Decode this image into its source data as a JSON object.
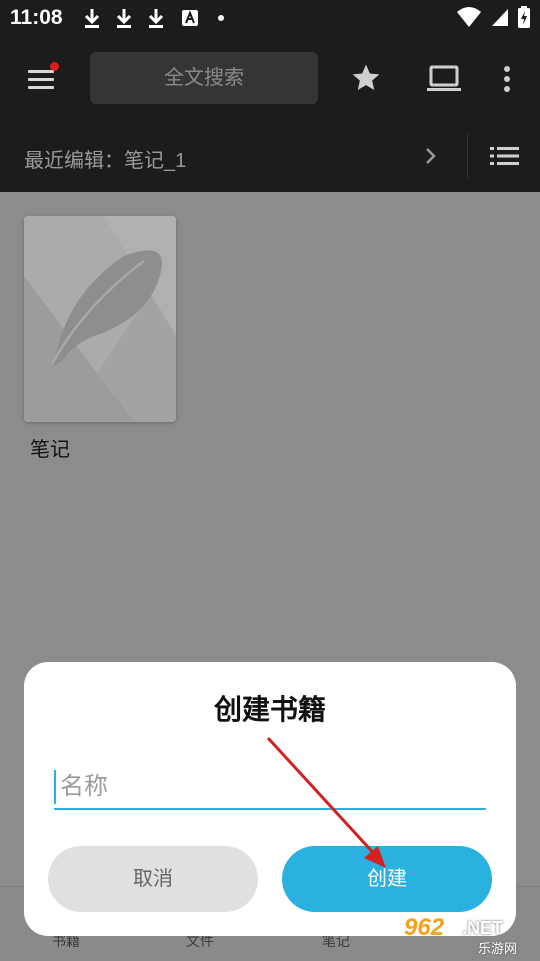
{
  "status_bar": {
    "time": "11:08",
    "notification_icons": [
      "download-icon",
      "download-icon",
      "download-icon",
      "text-icon"
    ],
    "system_icons": [
      "wifi-icon",
      "signal-icon",
      "battery-charging-icon"
    ]
  },
  "app_bar": {
    "search_placeholder": "全文搜索",
    "icons": [
      "menu-icon",
      "star-icon",
      "laptop-icon",
      "more-vertical-icon"
    ],
    "badge_color": "#e01b1b"
  },
  "recent": {
    "label": "最近编辑：笔记_1"
  },
  "books": [
    {
      "title": "笔记"
    }
  ],
  "bottom_nav": {
    "tabs": [
      "书籍",
      "文件",
      "笔记"
    ]
  },
  "dialog": {
    "title": "创建书籍",
    "name_placeholder": "名称",
    "name_value": "",
    "cancel_label": "取消",
    "create_label": "创建",
    "accent_color": "#2ab1e0"
  },
  "watermark": {
    "num": "962",
    "net": ".NET",
    "sub": "乐游网"
  }
}
